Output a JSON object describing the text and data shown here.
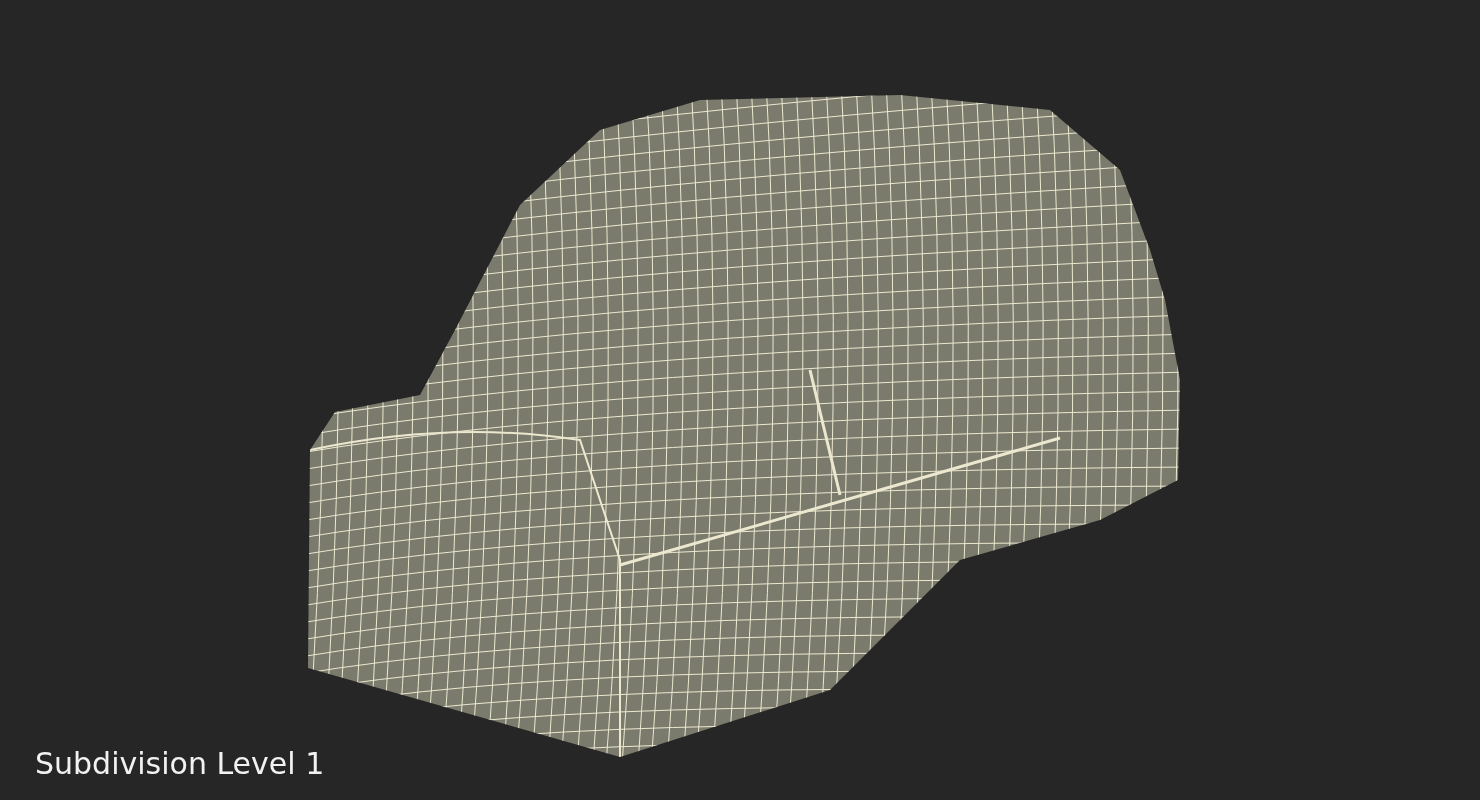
{
  "caption": "Subdivision Level 1"
}
